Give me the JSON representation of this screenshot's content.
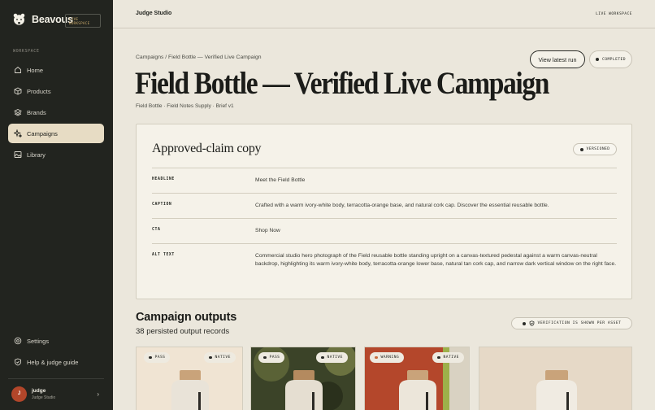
{
  "sidebar": {
    "brand": "Beavous",
    "badge_line1": "LIVE",
    "badge_line2": "WORKSPACE",
    "section": "WORKSPACE",
    "items": [
      {
        "label": "Home",
        "icon": "home-icon"
      },
      {
        "label": "Products",
        "icon": "box-icon"
      },
      {
        "label": "Brands",
        "icon": "layers-icon"
      },
      {
        "label": "Campaigns",
        "icon": "sparkle-icon",
        "active": true
      },
      {
        "label": "Library",
        "icon": "image-icon"
      }
    ],
    "bottom_items": [
      {
        "label": "Settings",
        "icon": "gear-icon"
      },
      {
        "label": "Help & judge guide",
        "icon": "shield-icon"
      }
    ],
    "user": {
      "initial": "J",
      "name": "judge",
      "org": "Judge Studio"
    }
  },
  "topbar": {
    "title": "Judge Studio",
    "tag": "LIVE WORKSPACE"
  },
  "header": {
    "breadcrumb": "Campaigns / Field Bottle — Verified Live Campaign",
    "title": "Field Bottle — Verified Live Campaign",
    "subline": "Field Bottle · Field Notes Supply · Brief v1",
    "run_button": "View latest run",
    "status": "COMPLETED"
  },
  "copy": {
    "title": "Approved-claim copy",
    "badge": "VERSIONED",
    "rows": [
      {
        "key": "HEADLINE",
        "value": "Meet the Field Bottle"
      },
      {
        "key": "CAPTION",
        "value": "Crafted with a warm ivory-white body, terracotta-orange base, and natural cork cap. Discover the essential reusable bottle."
      },
      {
        "key": "CTA",
        "value": "Shop Now"
      },
      {
        "key": "ALT TEXT",
        "value": "Commercial studio hero photograph of the Field reusable bottle standing upright on a canvas-textured pedestal against a warm canvas-neutral backdrop, highlighting its warm ivory-white body, terracotta-orange lower base, natural tan cork cap, and narrow dark vertical window on the right face."
      }
    ]
  },
  "outputs": {
    "title": "Campaign outputs",
    "count": "38 persisted output records",
    "verify_note": "VERIFICATION IS SHOWN PER ASSET",
    "assets": [
      {
        "status": "PASS",
        "badge": "NATIVE",
        "status_color": "#2a2b27"
      },
      {
        "status": "PASS",
        "badge": "NATIVE",
        "status_color": "#2a2b27"
      },
      {
        "status": "WARNING",
        "badge": "NATIVE",
        "status_color": "#c96a3a"
      },
      {
        "status": "",
        "badge": ""
      }
    ]
  },
  "colors": {
    "sidebar": "#22241f",
    "active_nav": "#e7dcc4",
    "canvas": "#ebe7dc",
    "terracotta": "#b2462a"
  }
}
